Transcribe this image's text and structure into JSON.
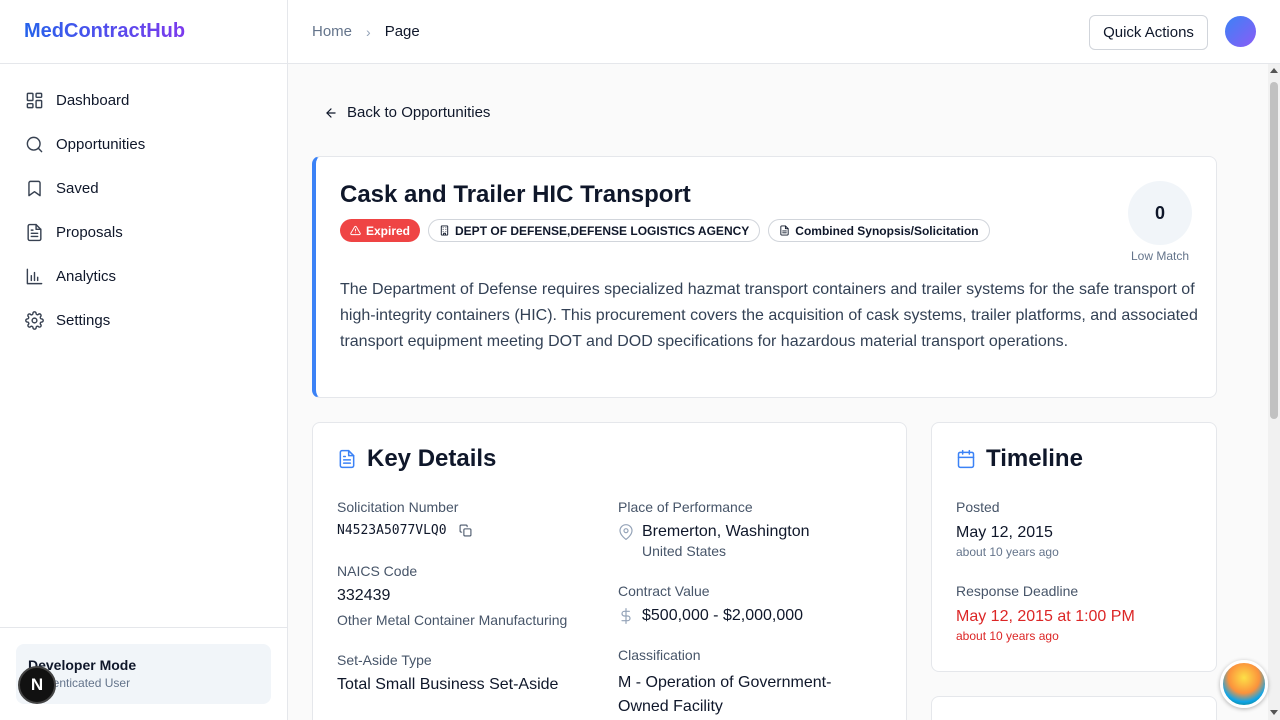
{
  "brand": "MedContractHub",
  "sidebar": {
    "items": [
      {
        "label": "Dashboard",
        "icon": "dashboard-icon"
      },
      {
        "label": "Opportunities",
        "icon": "search-icon"
      },
      {
        "label": "Saved",
        "icon": "bookmark-icon"
      },
      {
        "label": "Proposals",
        "icon": "document-icon"
      },
      {
        "label": "Analytics",
        "icon": "bar-chart-icon"
      },
      {
        "label": "Settings",
        "icon": "gear-icon"
      }
    ],
    "footer": {
      "title": "Developer Mode",
      "subtitle": "Authenticated User"
    }
  },
  "header": {
    "breadcrumb": [
      "Home",
      "Page"
    ],
    "quick_actions": "Quick Actions"
  },
  "main": {
    "back_label": "Back to Opportunities",
    "opportunity": {
      "title": "Cask and Trailer HIC Transport",
      "status_badge": "Expired",
      "agency_badge": "DEPT OF DEFENSE,DEFENSE LOGISTICS AGENCY",
      "type_badge": "Combined Synopsis/Solicitation",
      "match_score": "0",
      "match_label": "Low Match",
      "description": "The Department of Defense requires specialized hazmat transport containers and trailer systems for the safe transport of high-integrity containers (HIC). This procurement covers the acquisition of cask systems, trailer platforms, and associated transport equipment meeting DOT and DOD specifications for hazardous material transport operations."
    },
    "key_details": {
      "title": "Key Details",
      "solicitation_label": "Solicitation Number",
      "solicitation_value": "N4523A5077VLQ0",
      "naics_label": "NAICS Code",
      "naics_value": "332439",
      "naics_desc": "Other Metal Container Manufacturing",
      "setaside_label": "Set-Aside Type",
      "setaside_value": "Total Small Business Set-Aside",
      "place_label": "Place of Performance",
      "place_city": "Bremerton, Washington",
      "place_country": "United States",
      "contract_label": "Contract Value",
      "contract_value": "$500,000 - $2,000,000",
      "class_label": "Classification",
      "class_value_line1": "M - Operation of Government-",
      "class_value_line2": "Owned Facility"
    },
    "timeline": {
      "title": "Timeline",
      "posted_label": "Posted",
      "posted_value": "May 12, 2015",
      "posted_rel": "about 10 years ago",
      "deadline_label": "Response Deadline",
      "deadline_value": "May 12, 2015 at 1:00 PM",
      "deadline_rel": "about 10 years ago"
    }
  },
  "colors": {
    "accent": "#3b82f6",
    "expired": "#ef4444",
    "deadline": "#dc2626"
  }
}
